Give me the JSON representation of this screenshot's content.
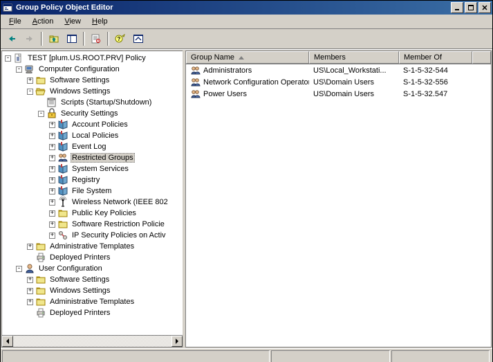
{
  "title": "Group Policy Object Editor",
  "menu": {
    "file": "File",
    "action": "Action",
    "view": "View",
    "help": "Help"
  },
  "tree": {
    "root": "TEST [plum.US.ROOT.PRV] Policy",
    "computer_config": "Computer Configuration",
    "cc_software": "Software Settings",
    "cc_windows": "Windows Settings",
    "cc_scripts": "Scripts (Startup/Shutdown)",
    "cc_security": "Security Settings",
    "sec_account": "Account Policies",
    "sec_local": "Local Policies",
    "sec_eventlog": "Event Log",
    "sec_restricted": "Restricted Groups",
    "sec_services": "System Services",
    "sec_registry": "Registry",
    "sec_filesystem": "File System",
    "sec_wireless": "Wireless Network (IEEE 802",
    "sec_pubkey": "Public Key Policies",
    "sec_softrestrict": "Software Restriction Policie",
    "sec_ipsec": "IP Security Policies on Activ",
    "cc_admin": "Administrative Templates",
    "cc_printers": "Deployed Printers",
    "user_config": "User Configuration",
    "uc_software": "Software Settings",
    "uc_windows": "Windows Settings",
    "uc_admin": "Administrative Templates",
    "uc_printers": "Deployed Printers"
  },
  "cols": {
    "name": "Group Name",
    "members": "Members",
    "memberof": "Member Of"
  },
  "rows": [
    {
      "name": "Administrators",
      "members": "US\\Local_Workstati...",
      "memberof": "S-1-5-32-544"
    },
    {
      "name": "Network Configuration Operators",
      "members": "US\\Domain Users",
      "memberof": "S-1-5-32-556"
    },
    {
      "name": "Power Users",
      "members": "US\\Domain Users",
      "memberof": "S-1-5-32.547"
    }
  ]
}
